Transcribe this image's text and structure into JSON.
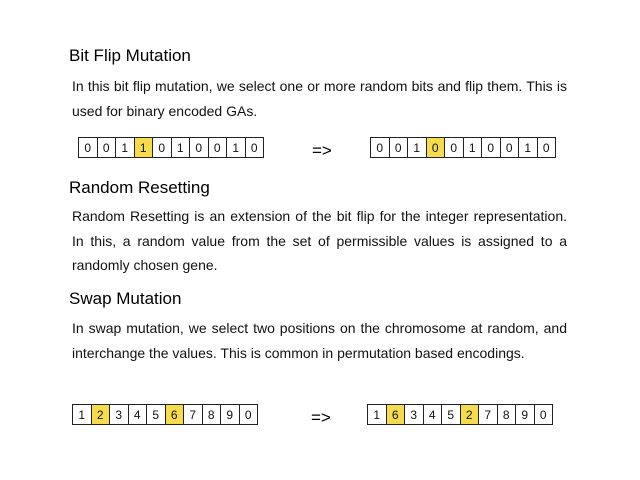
{
  "colors": {
    "highlight": "#f6dc4c",
    "border": "#222222"
  },
  "bit_flip": {
    "title": "Bit Flip Mutation",
    "description": "In this bit flip mutation, we select one or more random bits and flip them. This is used for binary encoded GAs.",
    "arrow": "=>",
    "before": {
      "cells": [
        "0",
        "0",
        "1",
        "1",
        "0",
        "1",
        "0",
        "0",
        "1",
        "0"
      ],
      "highlighted": [
        3
      ]
    },
    "after": {
      "cells": [
        "0",
        "0",
        "1",
        "0",
        "0",
        "1",
        "0",
        "0",
        "1",
        "0"
      ],
      "highlighted": [
        3
      ]
    }
  },
  "random_resetting": {
    "title": "Random Resetting",
    "description": "Random Resetting is an extension of the bit flip for the integer representation. In this, a random value from the set of permissible values is assigned to a randomly chosen gene."
  },
  "swap": {
    "title": "Swap Mutation",
    "description": "In swap mutation, we select two positions on the chromosome at random, and interchange the values. This is common in permutation based encodings.",
    "arrow": "=>",
    "before": {
      "cells": [
        "1",
        "2",
        "3",
        "4",
        "5",
        "6",
        "7",
        "8",
        "9",
        "0"
      ],
      "highlighted": [
        1,
        5
      ]
    },
    "after": {
      "cells": [
        "1",
        "6",
        "3",
        "4",
        "5",
        "2",
        "7",
        "8",
        "9",
        "0"
      ],
      "highlighted": [
        1,
        5
      ]
    }
  }
}
